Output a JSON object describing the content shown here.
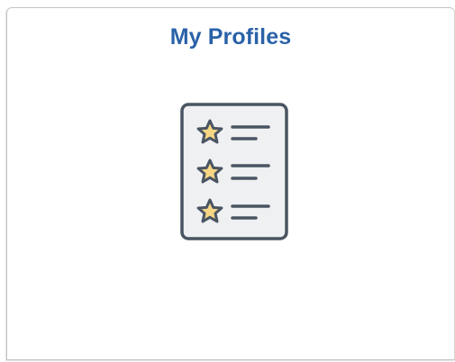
{
  "tile": {
    "title": "My Profiles",
    "icon": "star-rated-list-icon"
  },
  "colors": {
    "title": "#2a62a8",
    "icon_stroke": "#4a5563",
    "icon_fill": "#eef0f2",
    "star_fill": "#f6d684",
    "tile_border": "#c4c4c4"
  }
}
